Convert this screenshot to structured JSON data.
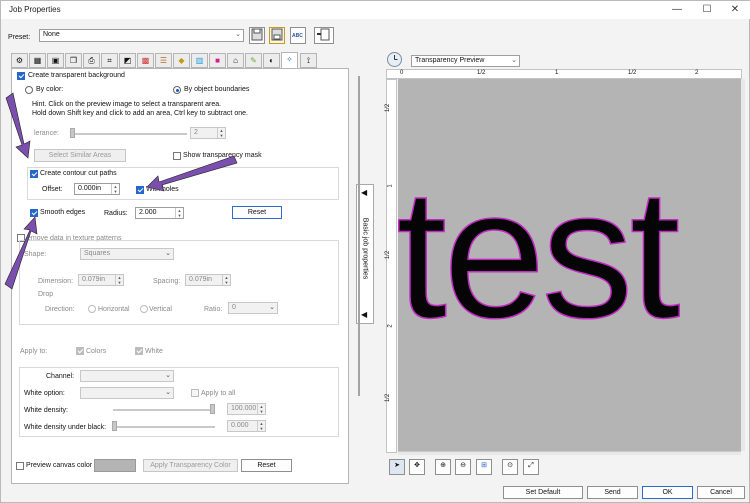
{
  "window": {
    "title": "Job Properties",
    "min": "—",
    "max": "☐",
    "close": "✕"
  },
  "preset": {
    "label": "Preset:",
    "value": "None"
  },
  "transparency": {
    "create_bg": "Create transparent background",
    "by_color": "By color:",
    "by_object": "By object boundaries",
    "hint1": "Hint. Click on the preview image to select a transparent area.",
    "hint2": "Hold down Shift key and click to add an area, Ctrl key to subtract one.",
    "tolerance_label": "lerance:",
    "tolerance_value": "2",
    "select_similar": "Select Similar Areas",
    "show_mask": "Show transparency mask",
    "contour": "Create contour cut paths",
    "offset_label": "Offset:",
    "offset_value": "0.000in",
    "with_holes": "With holes",
    "smooth_edges": "Smooth edges",
    "radius_label": "Radius:",
    "radius_value": "2.000",
    "reset": "Reset"
  },
  "texture": {
    "remove": "emove data in texture patterns",
    "shape_label": "Shape:",
    "shape_value": "Squares",
    "dimension_label": "Dimension:",
    "dimension_value": "0.079in",
    "spacing_label": "Spacing:",
    "spacing_value": "0.079in",
    "drop_label": "Drop",
    "direction_label": "Direction:",
    "horizontal": "Horizontal",
    "vertical": "Vertical",
    "ratio_label": "Ratio:",
    "ratio_value": "0",
    "apply_to": "Apply to:",
    "colors": "Colors",
    "white": "White"
  },
  "white": {
    "channel_label": "Channel:",
    "white_option_label": "White option:",
    "apply_all": "Apply to all",
    "density_label": "White density:",
    "density_value": "100.000",
    "density_under_label": "White density under black:",
    "density_under_value": "0.000"
  },
  "bottom_left": {
    "preview_canvas": "Preview canvas color",
    "apply_transparency": "Apply Transparency Color",
    "reset": "Reset"
  },
  "side_tab": {
    "label": "Basic job properties"
  },
  "preview": {
    "mode": "Transparency Preview",
    "ruler_top": [
      "0",
      "1/2",
      "1",
      "1/2",
      "2"
    ],
    "ruler_left": [
      "1/2",
      "1",
      "1/2",
      "2",
      "1/2"
    ],
    "text": "test"
  },
  "footer": {
    "set_default": "Set Default",
    "send": "Send",
    "ok": "OK",
    "cancel": "Cancel"
  }
}
